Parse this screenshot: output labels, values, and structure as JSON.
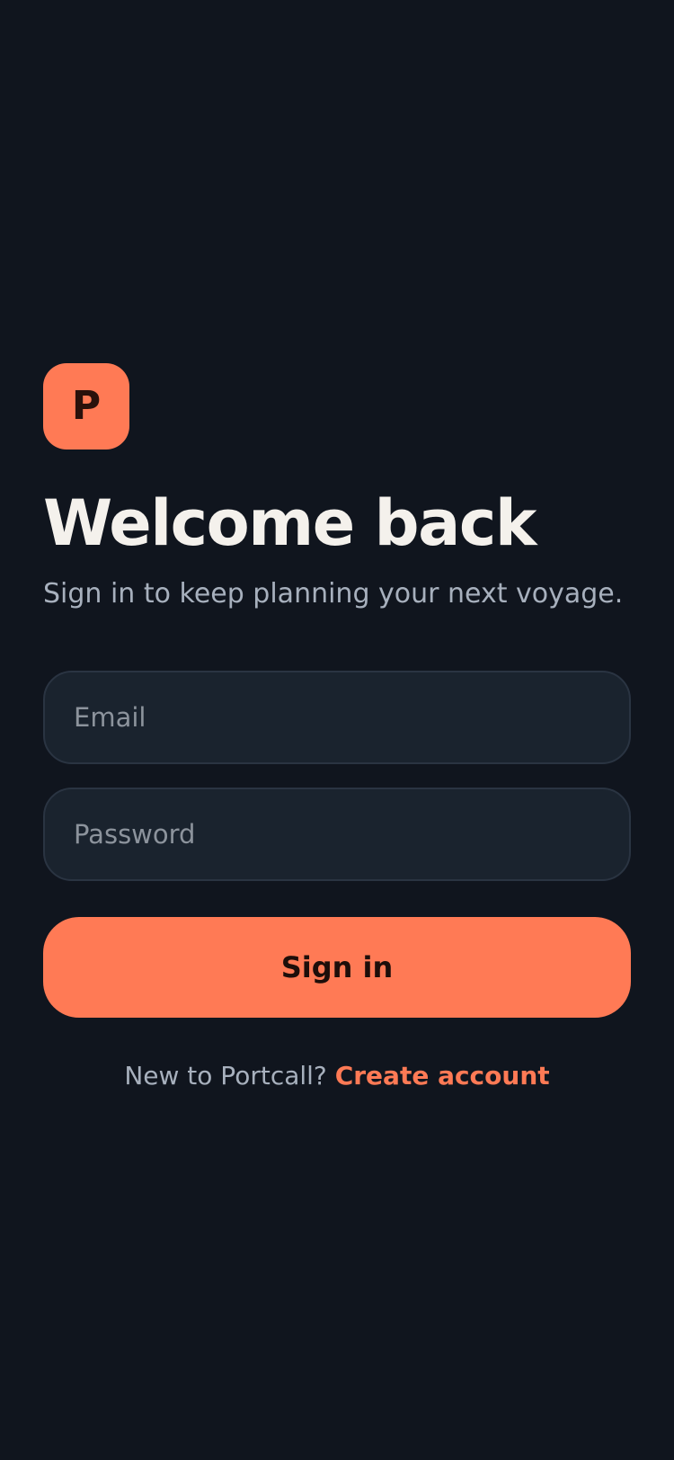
{
  "app": {
    "logo_letter": "P",
    "title": "Welcome back",
    "subtitle": "Sign in to keep planning your next voyage."
  },
  "form": {
    "email_placeholder": "Email",
    "email_value": "",
    "password_placeholder": "Password",
    "password_value": "",
    "submit_label": "Sign in"
  },
  "footer": {
    "prompt": "New to Portcall?",
    "link_label": "Create account"
  },
  "colors": {
    "background": "#10151e",
    "accent": "#ff7a55",
    "field_background": "#1a232e",
    "field_border": "#2a3442"
  }
}
